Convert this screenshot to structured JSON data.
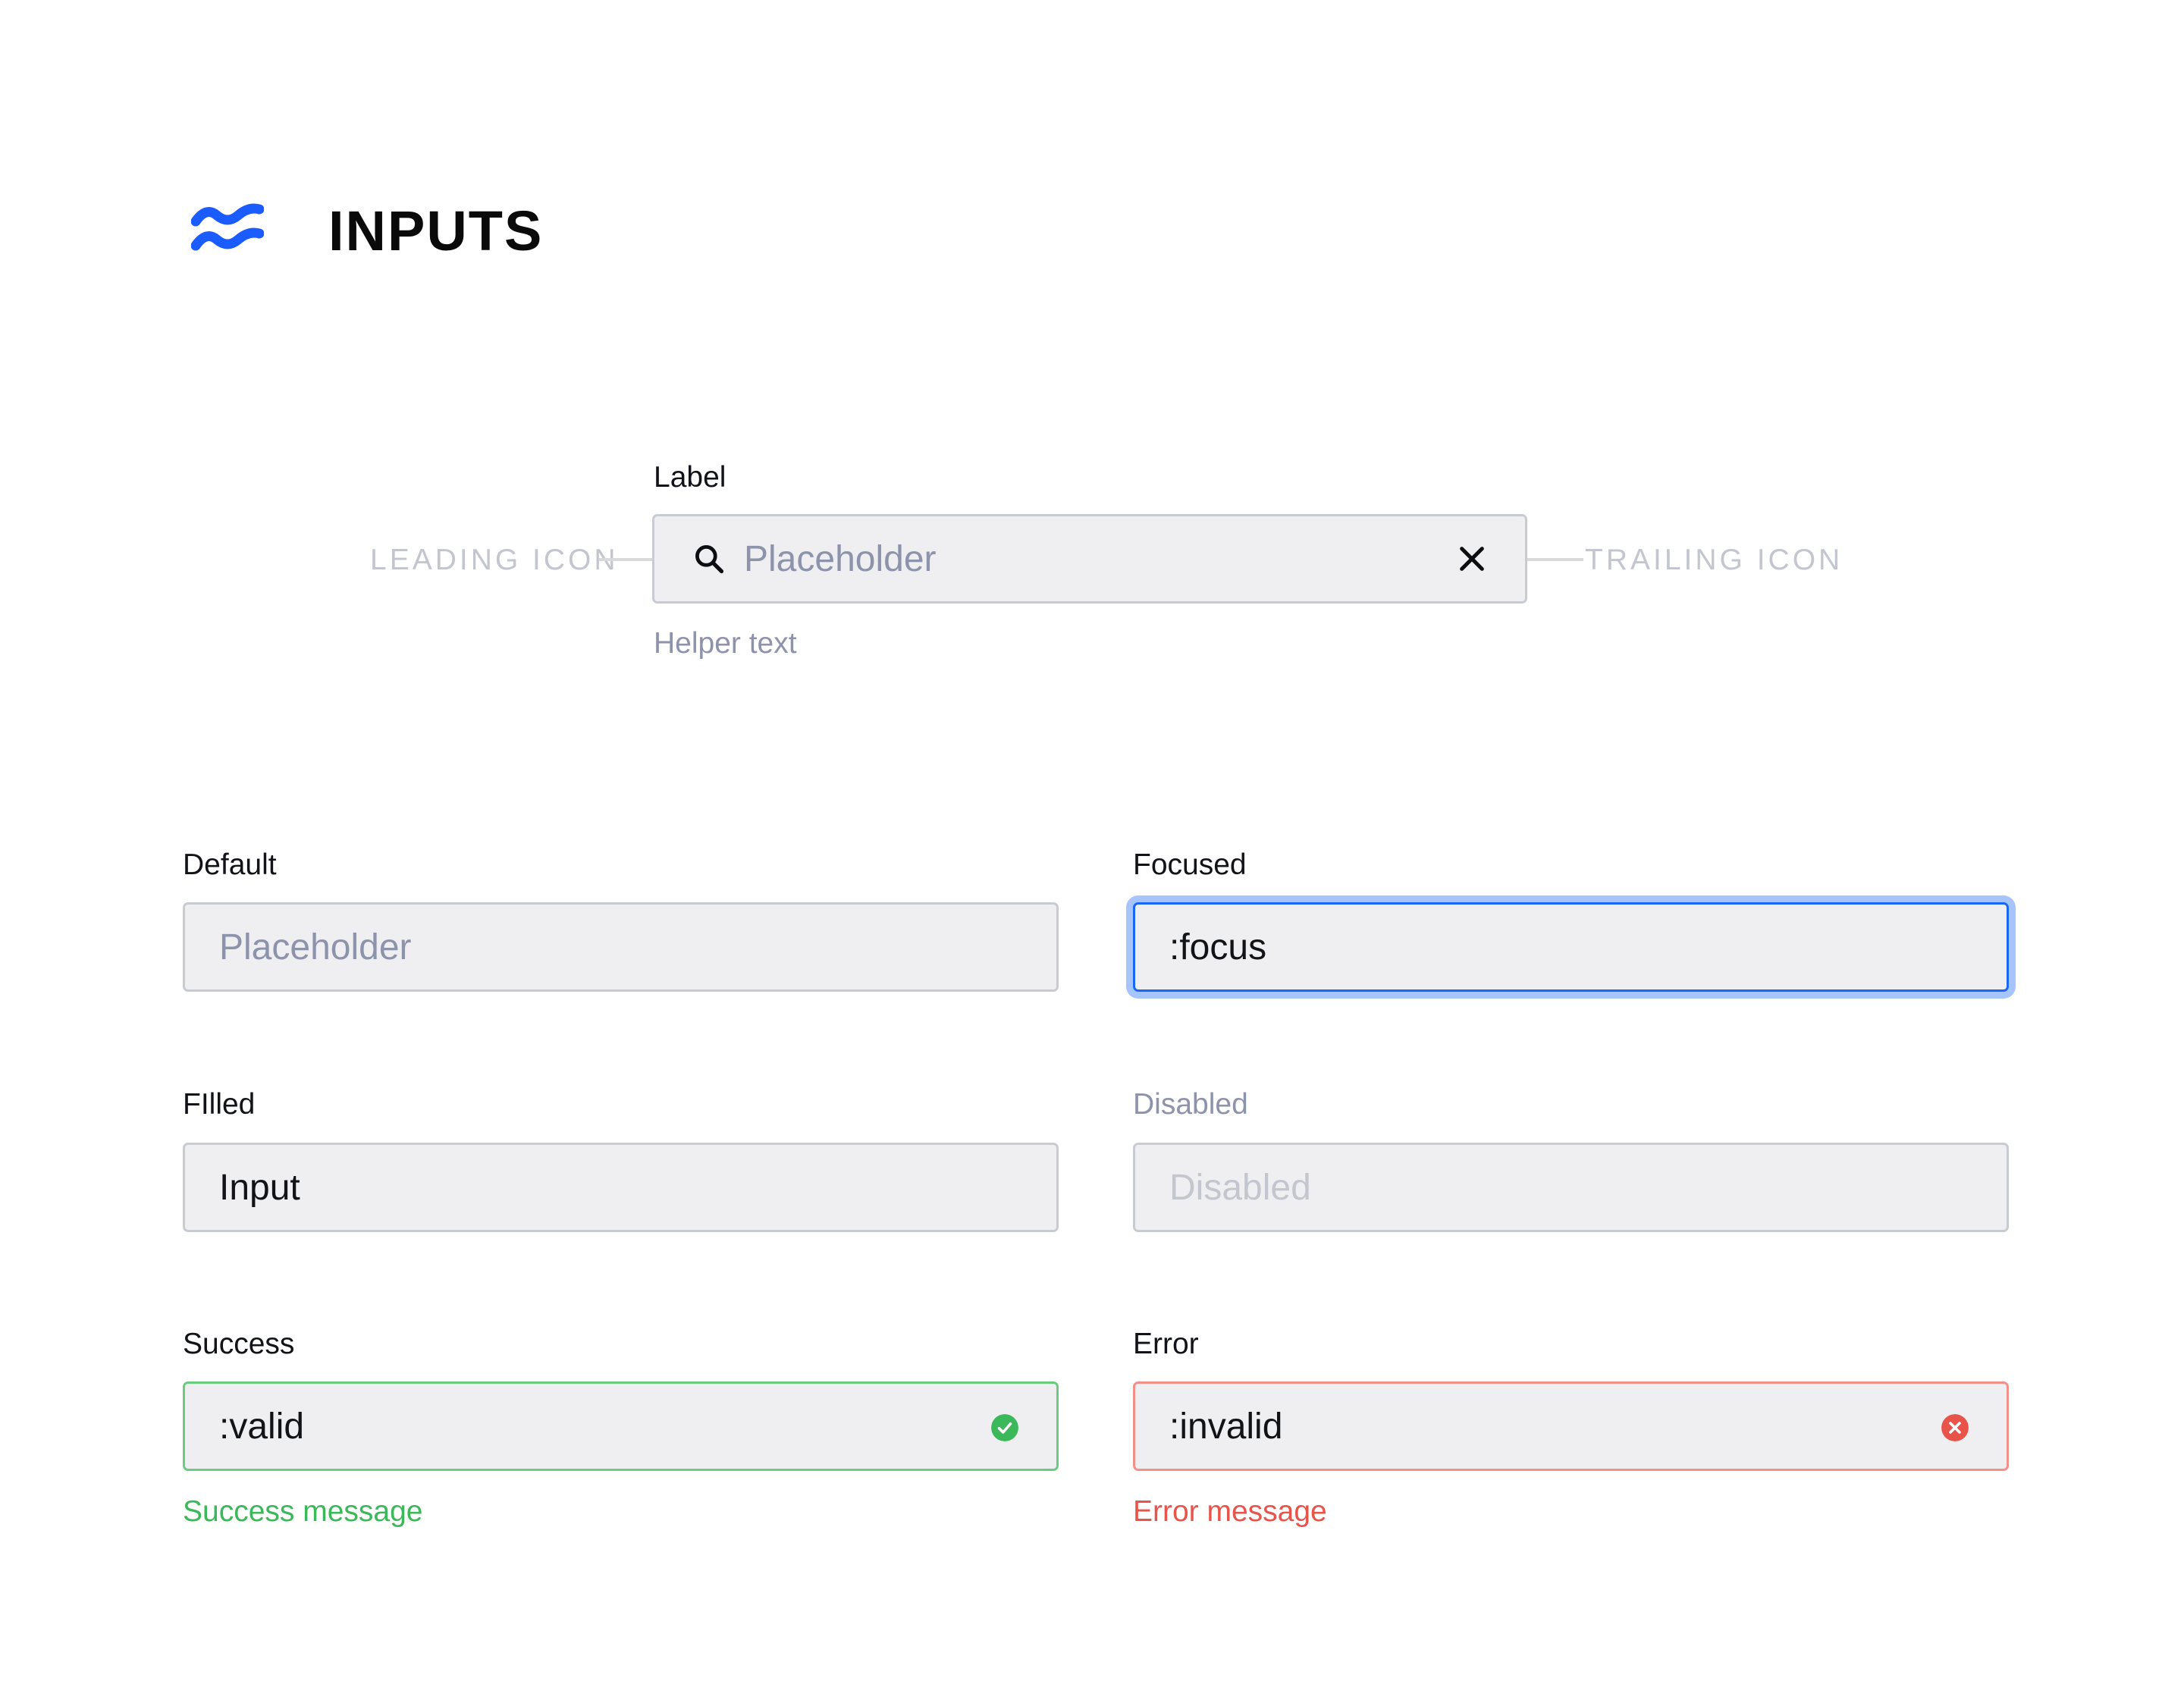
{
  "header": {
    "title": "INPUTS",
    "logo_icon": "wave-approx-icon",
    "accent": "#1a5cff"
  },
  "anatomy": {
    "label": "Label",
    "placeholder": "Placeholder",
    "helper_text": "Helper text",
    "leading_icon_annotation": "LEADING ICON",
    "trailing_icon_annotation": "TRAILING ICON",
    "leading_icon": "search-icon",
    "trailing_icon": "close-icon"
  },
  "states": {
    "default": {
      "label": "Default",
      "placeholder": "Placeholder"
    },
    "focused": {
      "label": "Focused",
      "value": ":focus",
      "border_color": "#1a66f5",
      "ring_color": "#a6c4fd"
    },
    "filled": {
      "label": "FIlled",
      "value": "Input"
    },
    "disabled": {
      "label": "Disabled",
      "placeholder": "Disabled"
    },
    "success": {
      "label": "Success",
      "value": ":valid",
      "message": "Success message",
      "color": "#3bb85a",
      "icon": "check-circle-icon"
    },
    "error": {
      "label": "Error",
      "value": ":invalid",
      "message": "Error message",
      "color": "#e8544a",
      "icon": "x-circle-icon"
    }
  }
}
